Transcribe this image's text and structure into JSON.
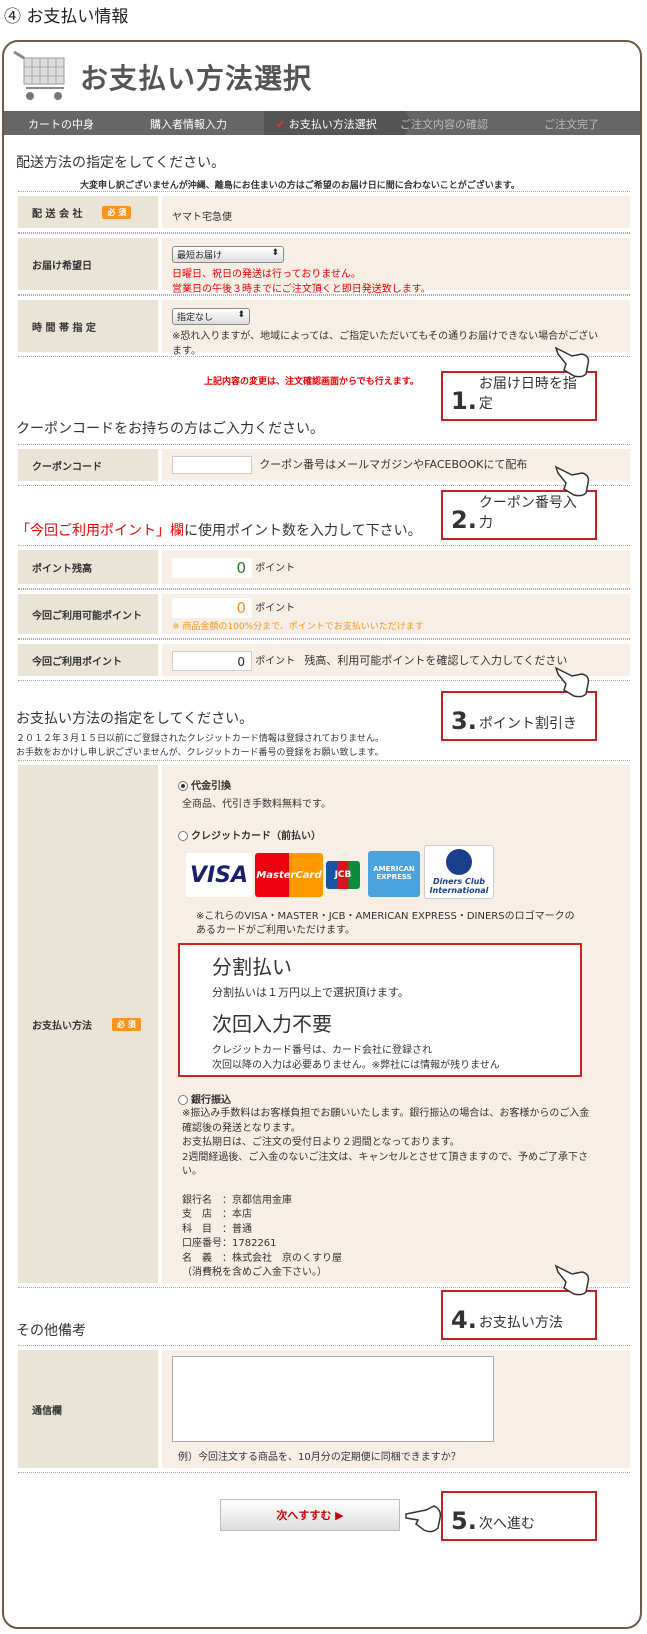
{
  "heading": "④ お支払い情報",
  "title": "お支払い方法選択",
  "steps": [
    "カートの中身",
    "購入者情報入力",
    "お支払い方法選択",
    "ご注文内容の確認",
    "ご注文完了"
  ],
  "delivery": {
    "section_title": "配送方法の指定をしてください。",
    "notice": "大変申し訳ございませんが沖縄、離島にお住まいの方はご希望のお届け日に間に合わないことがございます。",
    "carrier_label": "配 送 会 社",
    "required": "必 須",
    "carrier_value": "ヤマト宅急便",
    "date_label": "お届け希望日",
    "date_select": "最短お届け",
    "date_note1": "日曜日、祝日の発送は行っておりません。",
    "date_note2": "営業日の午後３時までにご注文頂くと即日発送致します。",
    "time_label": "時 間 帯 指 定",
    "time_select": "指定なし",
    "time_note": "※恐れ入りますが、地域によっては、ご指定いただいてもその通りお届けできない場合がございます。",
    "change_note": "上記内容の変更は、注文確認画面からでも行えます。"
  },
  "coupon": {
    "section_title": "クーポンコードをお持ちの方はご入力ください。",
    "label": "クーポンコード",
    "hint": "クーポン番号はメールマガジンやFACEBOOKにて配布"
  },
  "points": {
    "title_red": "「今回ご利用ポイント」欄",
    "title_rest": "に使用ポイント数を入力して下さい。",
    "balance_label": "ポイント残高",
    "balance_value": "0",
    "unit": "ポイント",
    "avail_label": "今回ご利用可能ポイント",
    "avail_value": "0",
    "avail_note": "※ 商品金額の100%分まで、ポイントでお支払いいただけます",
    "use_label": "今回ご利用ポイント",
    "use_value": "0",
    "hint": "残高、利用可能ポイントを確認して入力してください"
  },
  "payment": {
    "section_title": "お支払い方法の指定をしてください。",
    "note1": "２０１２年３月１５日以前にご登録されたクレジットカード情報は登録されておりません。",
    "note2": "お手数をおかけし申し訳ございませんが、クレジットカード番号の登録をお願い致します。",
    "label": "お支払い方法",
    "required": "必 須",
    "cod_label": "代金引換",
    "cod_note": "全商品、代引き手数料無料です。",
    "credit_label": "クレジットカード（前払い）",
    "cards": [
      "VISA",
      "MasterCard",
      "JCB",
      "AMERICAN EXPRESS",
      "Diners Club International"
    ],
    "card_note1": "※これらのVISA・MASTER・JCB・AMERICAN EXPRESS・DINERSのロゴマークの",
    "card_note2": "あるカードがご利用いただけます。",
    "installment_title": "分割払い",
    "installment_note": "分割払いは１万円以上で選択頂けます。",
    "noinput_title": "次回入力不要",
    "noinput_note1": "クレジットカード番号は、カード会社に登録され",
    "noinput_note2": "次回以降の入力は必要ありません。※弊社には情報が残りません",
    "bank_label": "銀行振込",
    "bank_note1": "※振込み手数料はお客様負担でお願いいたします。銀行振込の場合は、お客様からのご入金確認後の発送となります。",
    "bank_note2": "お支払期日は、ご注文の受付日より２週間となっております。",
    "bank_note3": "2週間経過後、ご入金のないご注文は、キャンセルとさせて頂きますので、予めご了承下さい。",
    "bank_lines": [
      "銀行名　：京都信用金庫",
      "支　店　：本店",
      "科　目　：普通",
      "口座番号：1782261",
      "名　義　：株式会社　京のくすり屋",
      "（消費税を含めご入金下さい。）"
    ]
  },
  "other": {
    "section_title": "その他備考",
    "label": "通信欄",
    "example": "例）今回注文する商品を、10月分の定期便に同梱できますか？"
  },
  "next_button": "次へすすむ ▶",
  "callouts": [
    {
      "num": "1.",
      "text": "お届け日時を指定"
    },
    {
      "num": "2.",
      "text": "クーポン番号入力"
    },
    {
      "num": "3.",
      "text": "ポイント割引き"
    },
    {
      "num": "4.",
      "text": "お支払い方法"
    },
    {
      "num": "5.",
      "text": "次へ進む"
    }
  ]
}
